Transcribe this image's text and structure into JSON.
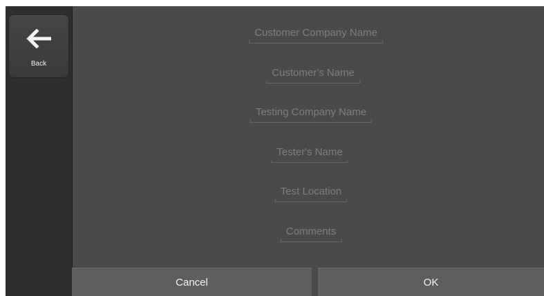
{
  "sidebar": {
    "back": {
      "label": "Back",
      "icon": "arrow-left-icon"
    }
  },
  "form": {
    "fields": [
      {
        "placeholder": "Customer Company Name"
      },
      {
        "placeholder": "Customer's Name"
      },
      {
        "placeholder": "Testing Company Name"
      },
      {
        "placeholder": "Tester's Name"
      },
      {
        "placeholder": "Test Location"
      },
      {
        "placeholder": "Comments"
      }
    ]
  },
  "actions": {
    "cancel_label": "Cancel",
    "ok_label": "OK"
  },
  "colors": {
    "background": "#4a4a4a",
    "sidebar": "#2e2e2e",
    "placeholder_text": "#7d7d7d",
    "button": "#5e5e5e",
    "button_text": "#f4f4f4"
  }
}
